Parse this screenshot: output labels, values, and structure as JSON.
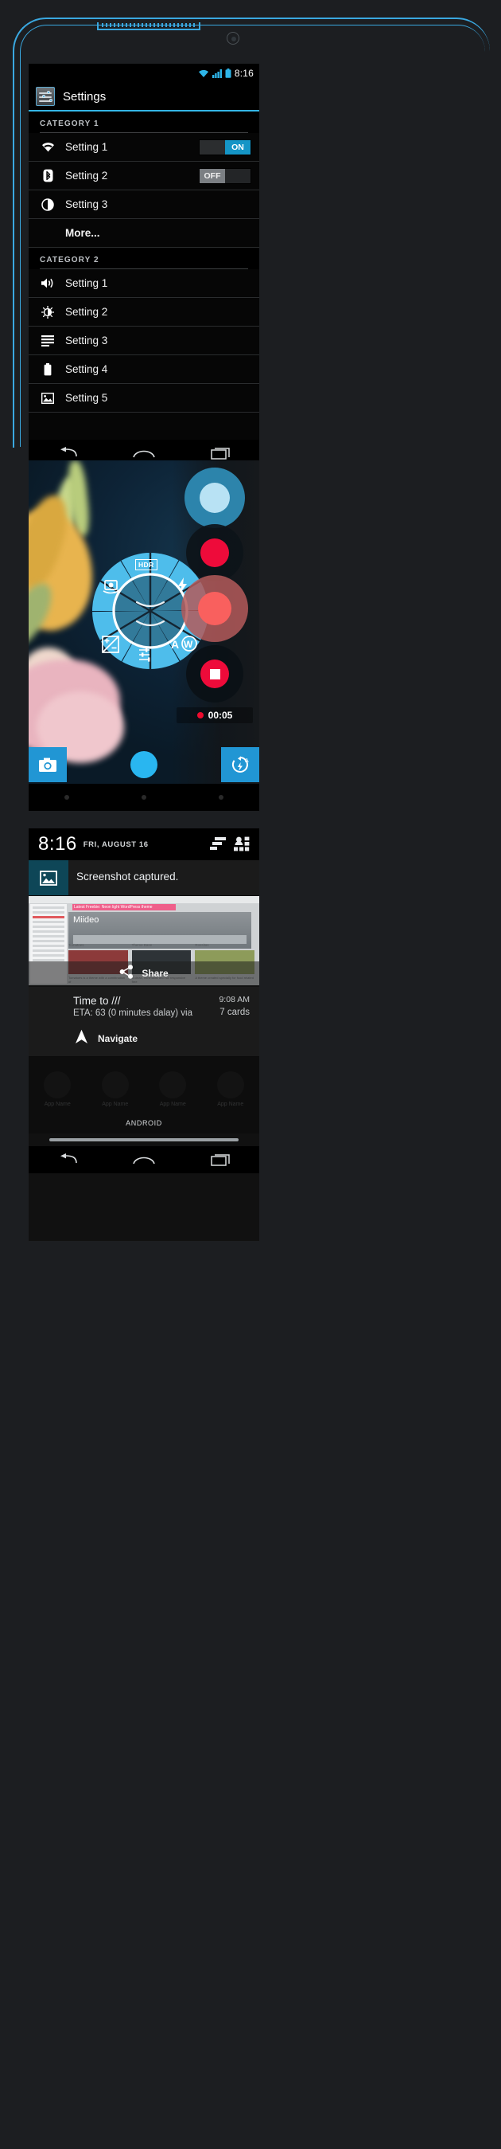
{
  "settings_screen": {
    "statusbar": {
      "time": "8:16",
      "icons": [
        "wifi-icon",
        "signal-icon",
        "battery-icon"
      ]
    },
    "actionbar": {
      "title": "Settings",
      "icon": "settings-sliders-icon"
    },
    "categories": [
      {
        "label": "CATEGORY 1",
        "rows": [
          {
            "label": "Setting 1",
            "icon": "wifi-icon",
            "toggle": "ON",
            "toggle_state": "on"
          },
          {
            "label": "Setting 2",
            "icon": "bluetooth-icon",
            "toggle": "OFF",
            "toggle_state": "off"
          },
          {
            "label": "Setting 3",
            "icon": "contrast-icon",
            "toggle": null
          },
          {
            "label": "More...",
            "icon": null,
            "toggle": null
          }
        ]
      },
      {
        "label": "CATEGORY 2",
        "rows": [
          {
            "label": "Setting 1",
            "icon": "volume-icon",
            "toggle": null
          },
          {
            "label": "Setting 2",
            "icon": "brightness-icon",
            "toggle": null
          },
          {
            "label": "Setting 3",
            "icon": "list-icon",
            "toggle": null
          },
          {
            "label": "Setting 4",
            "icon": "battery-icon",
            "toggle": null
          },
          {
            "label": "Setting 5",
            "icon": "picture-icon",
            "toggle": null
          }
        ]
      }
    ],
    "navbar": [
      "back-icon",
      "home-icon",
      "recents-icon"
    ]
  },
  "camera_screen": {
    "dial_segments": [
      {
        "name": "switch-camera",
        "label": ""
      },
      {
        "name": "hdr",
        "label": "HDR"
      },
      {
        "name": "flash",
        "label": ""
      },
      {
        "name": "white-balance",
        "label": "AW"
      },
      {
        "name": "settings",
        "label": ""
      },
      {
        "name": "exposure",
        "label": ""
      }
    ],
    "recording": {
      "time": "00:05",
      "indicator": "record-dot"
    },
    "shutters": [
      {
        "name": "photo-shutter-blue",
        "color": "#2c9fd0"
      },
      {
        "name": "record-shutter-red",
        "color": "#ee0b3a"
      },
      {
        "name": "record-active-red",
        "color": "#f9605e"
      },
      {
        "name": "stop-shutter-red",
        "color": "#ee0b3a"
      }
    ],
    "bottom_bar": {
      "left_icon": "camera-icon",
      "center": "shutter-button",
      "right_icon": "flash-auto-icon"
    },
    "navbar": [
      "nav-dot",
      "nav-dot",
      "nav-dot"
    ]
  },
  "notification_screen": {
    "header": {
      "time": "8:16",
      "date": "FRI, AUGUST 16",
      "clear_icon": "clear-all-icon",
      "quicksettings_icon": "quick-settings-icon"
    },
    "screenshot_notification": {
      "title": "Screenshot captured.",
      "icon": "image-icon",
      "action_label": "Share",
      "action_icon": "share-icon",
      "preview": {
        "banner": "Latest Freebie:  Neon light WordPress theme",
        "hero_title": "Miideo",
        "cards": [
          {
            "caption": "Tomatoes",
            "date": "January 07, 2013",
            "body": "Tomatoes is a theme with a combination of"
          },
          {
            "caption": "Theme Base",
            "date": "January 17, 2013",
            "body": "A clean, minimalist and full responsive free"
          },
          {
            "caption": "Rossitas",
            "date": "January 21, 2013",
            "body": "A theme created specially for food related"
          }
        ]
      }
    },
    "navigation_notification": {
      "title": "Time to ///",
      "subtitle": "ETA: 63 (0 minutes dalay) via",
      "time": "9:08 AM",
      "count": "7 cards",
      "action_label": "Navigate",
      "action_icon": "navigation-arrow-icon"
    },
    "drawer": {
      "label": "ANDROID",
      "apps": [
        {
          "name": "App Name"
        },
        {
          "name": "App Name"
        },
        {
          "name": "App Name"
        },
        {
          "name": "App Name"
        }
      ]
    },
    "navbar": [
      "back-icon",
      "home-icon",
      "recents-icon"
    ]
  }
}
